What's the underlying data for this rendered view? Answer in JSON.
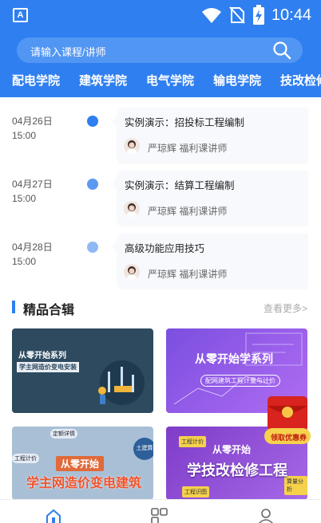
{
  "status_bar": {
    "app_icon_letter": "A",
    "time": "10:44"
  },
  "search": {
    "placeholder": "请输入课程/讲师"
  },
  "category_tabs": [
    "配电学院",
    "建筑学院",
    "电气学院",
    "输电学院",
    "技改检修"
  ],
  "schedule": [
    {
      "date": "04月26日",
      "time": "15:00",
      "title": "实例演示：招投标工程编制",
      "lecturer": "严琼辉 福利课讲师",
      "dot_color": "#2f7ff0"
    },
    {
      "date": "04月27日",
      "time": "15:00",
      "title": "实例演示：结算工程编制",
      "lecturer": "严琼辉 福利课讲师",
      "dot_color": "#5c9af2"
    },
    {
      "date": "04月28日",
      "time": "15:00",
      "title": "高级功能应用技巧",
      "lecturer": "严琼辉 福利课讲师",
      "dot_color": "#8fb8f5"
    }
  ],
  "section": {
    "title": "精品合辑",
    "more": "查看更多>"
  },
  "courses": [
    {
      "title": "从零开始系列",
      "subtitle": "学主网造价变电安装"
    },
    {
      "title": "从零开始学系列",
      "subtitle": "配网建筑工程计量与计价"
    },
    {
      "title_top": "从零开始",
      "title": "学主网造价变电建筑",
      "tags": [
        "定额详情",
        "工程计价",
        "土建算"
      ]
    },
    {
      "title_top": "从零开始",
      "title": "学技改检修工程",
      "tags": [
        "工程计价",
        "工程识图",
        "算量分析"
      ]
    }
  ],
  "red_packet": {
    "label": "领取优惠券"
  },
  "colors": {
    "primary": "#2f7ff0",
    "search_bg": "#5296f3",
    "red_packet": "#d8231e"
  }
}
